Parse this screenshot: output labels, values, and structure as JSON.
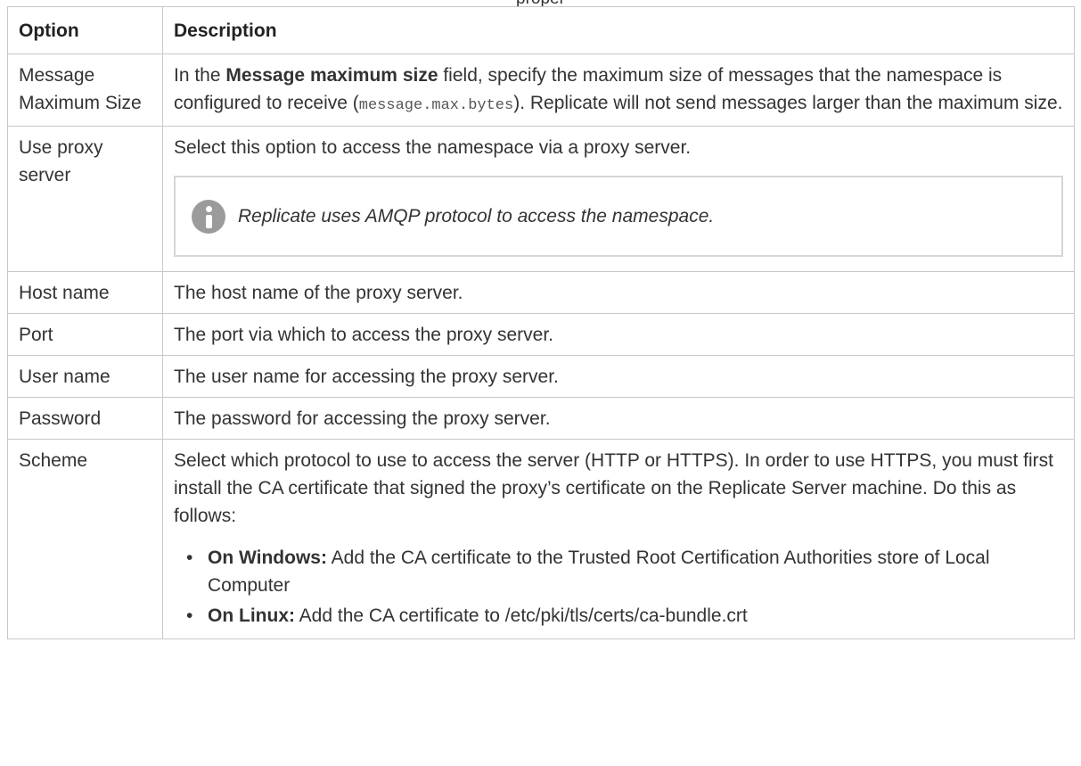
{
  "caption_fragment": "proper",
  "table": {
    "headers": [
      "Option",
      "Description"
    ],
    "rows": [
      {
        "option": "Message Maximum Size",
        "desc_prefix": "In the ",
        "desc_bold": "Message maximum size",
        "desc_mid": " field, specify the maximum size of messages that the namespace is configured to receive (",
        "desc_code": "message.max.bytes",
        "desc_suffix": "). Replicate will not send messages larger than the maximum size."
      },
      {
        "option": "Use proxy server",
        "description": "Select this option to access the namespace via a proxy server.",
        "note": "Replicate uses AMQP protocol to access the namespace."
      },
      {
        "option": "Host name",
        "description": "The host name of the proxy server."
      },
      {
        "option": "Port",
        "description": "The port via which to access the proxy server."
      },
      {
        "option": "User name",
        "description": "The user name for accessing the proxy server."
      },
      {
        "option": "Password",
        "description": "The password for accessing the proxy server."
      },
      {
        "option": "Scheme",
        "description": "Select which protocol to use to access the server (HTTP or HTTPS). In order to use HTTPS, you must first install the CA certificate that signed the proxy’s certificate on the Replicate Server machine. Do this as follows:",
        "bullets": [
          {
            "label": "On Windows:",
            "text": " Add the CA certificate to the Trusted Root Certification Authorities store of Local Computer"
          },
          {
            "label": "On Linux:",
            "text": " Add the CA certificate to /etc/pki/tls/certs/ca-bundle.crt"
          }
        ]
      }
    ]
  },
  "icons": {
    "note": "info-icon"
  },
  "colors": {
    "border": "#c8c8c8",
    "note_icon": "#9b9b9b",
    "text": "#333333"
  }
}
